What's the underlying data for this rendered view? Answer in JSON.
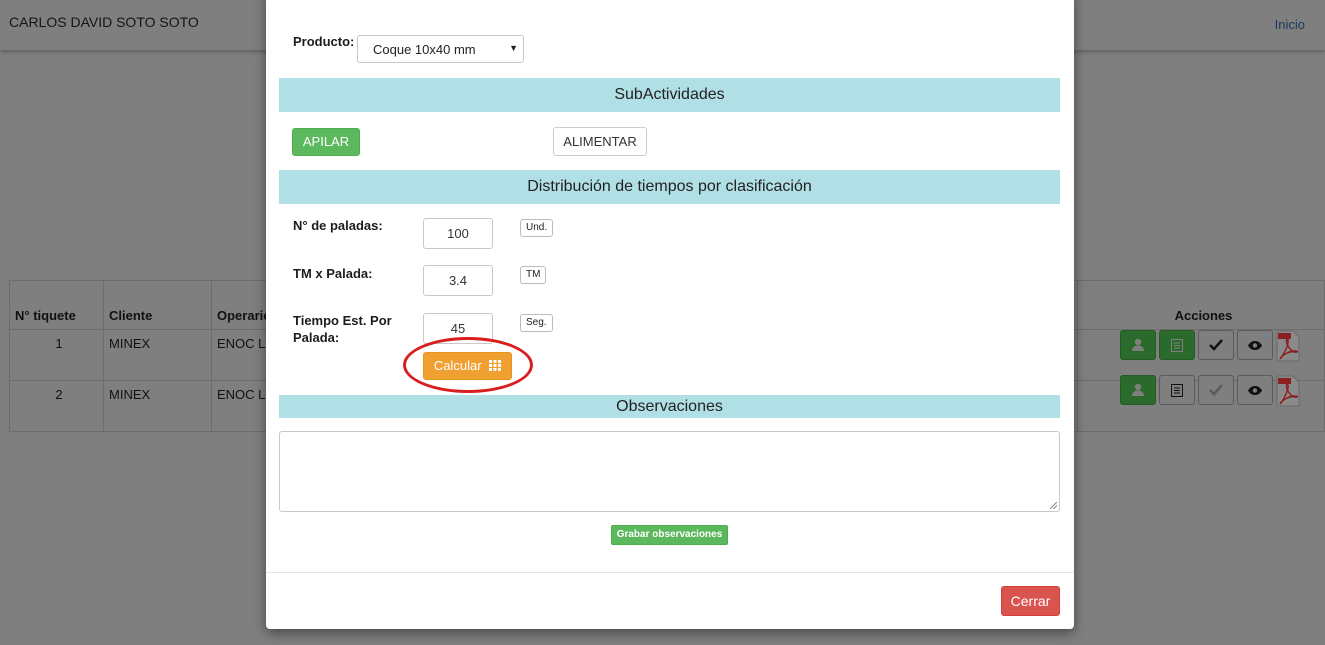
{
  "header": {
    "user_name": "CARLOS DAVID SOTO SOTO",
    "home_link": "Inicio"
  },
  "tickets_table": {
    "columns": [
      "N° tiquete",
      "Cliente",
      "Operario",
      "Acciones"
    ],
    "rows": [
      {
        "ticket": "1",
        "cliente": "MINEX",
        "operario": "ENOC LO"
      },
      {
        "ticket": "2",
        "cliente": "MINEX",
        "operario": "ENOC LO"
      }
    ],
    "action_icons": [
      "user-icon",
      "list-icon",
      "check-icon",
      "eye-icon",
      "pdf-icon"
    ]
  },
  "modal": {
    "producto_label": "Producto:",
    "producto_value": "Coque 10x40 mm",
    "subactividades_title": "SubActividades",
    "subactividades": [
      "APILAR",
      "ALIMENTAR"
    ],
    "distribucion_title": "Distribución de tiempos por clasificación",
    "fields": [
      {
        "label": "N° de paladas:",
        "value": "100",
        "unit": "Und."
      },
      {
        "label": "TM x Palada:",
        "value": "3.4",
        "unit": "TM"
      },
      {
        "label": "Tiempo Est. Por Palada:",
        "value": "45",
        "unit": "Seg."
      }
    ],
    "calcular_label": "Calcular",
    "observaciones_title": "Observaciones",
    "observaciones_value": "",
    "grabar_label": "Grabar observaciones",
    "cerrar_label": "Cerrar"
  },
  "colors": {
    "section_bar": "#b0dfe5",
    "success": "#5cb85c",
    "warning": "#f0a030",
    "danger": "#d9534f",
    "highlight_ring": "#d81e1e"
  }
}
